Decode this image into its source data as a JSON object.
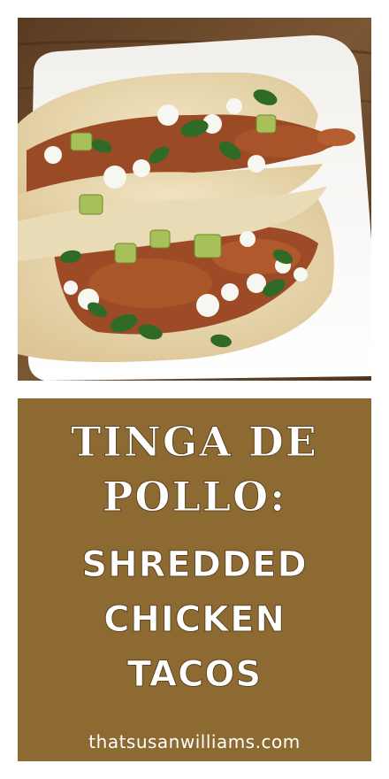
{
  "image": {
    "description_icon": "tacos-photo",
    "colors": {
      "banner": "#8e6a33",
      "text": "#ffffff",
      "table": "#6b4a2b",
      "plate": "#f7f4ef",
      "tortilla": "#ead9b1"
    }
  },
  "banner": {
    "title_line_1": "TINGA DE",
    "title_line_2": "POLLO:",
    "title_line_3": "SHREDDED",
    "title_line_4": "CHICKEN",
    "title_line_5": "TACOS",
    "website": "thatsusanwilliams.com"
  }
}
